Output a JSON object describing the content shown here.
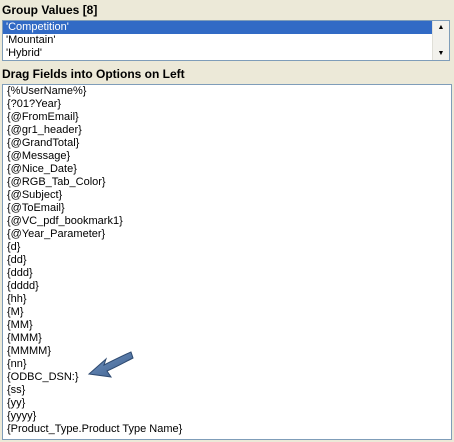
{
  "group_values": {
    "title": "Group Values [8]",
    "items": [
      "'Competition'",
      "'Mountain'",
      "'Hybrid'"
    ],
    "selected_index": 0
  },
  "fields": {
    "title": "Drag Fields into Options on Left",
    "items": [
      "{%UserName%}",
      "{?01?Year}",
      "{@FromEmail}",
      "{@gr1_header}",
      "{@GrandTotal}",
      "{@Message}",
      "{@Nice_Date}",
      "{@RGB_Tab_Color}",
      "{@Subject}",
      "{@ToEmail}",
      "{@VC_pdf_bookmark1}",
      "{@Year_Parameter}",
      "{d}",
      "{dd}",
      "{ddd}",
      "{dddd}",
      "{hh}",
      "{M}",
      "{MM}",
      "{MMM}",
      "{MMMM}",
      "{nn}",
      "{ODBC_DSN:}",
      "{ss}",
      "{yy}",
      "{yyyy}",
      "{Product_Type.Product Type Name}"
    ]
  },
  "icons": {
    "scroll_up": "scroll-up-arrow-icon",
    "scroll_down": "scroll-down-arrow-icon",
    "annotation": "annotation-arrow-icon"
  },
  "colors": {
    "selection": "#316ac5",
    "annotation_arrow": "#4a6f9c",
    "panel_bg": "#ece9d8"
  }
}
